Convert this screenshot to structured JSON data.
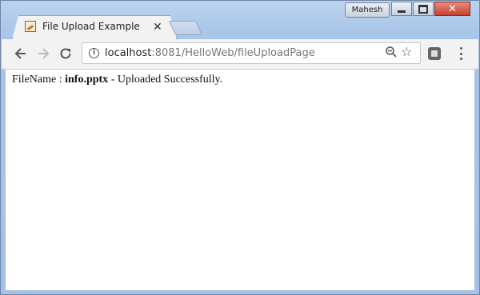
{
  "window": {
    "user_name": "Mahesh"
  },
  "tab": {
    "title": "File Upload Example",
    "close_glyph": "✕"
  },
  "address_bar": {
    "host": "localhost",
    "path": ":8081/HelloWeb/fileUploadPage"
  },
  "page": {
    "label": "FileName : ",
    "file_name": "info.pptx",
    "status": " - Uploaded Successfully."
  },
  "icons": {
    "back": "back-arrow-icon",
    "forward": "forward-arrow-icon",
    "reload": "reload-icon",
    "info": "info-icon",
    "zoom": "zoom-out-icon",
    "bookmark": "star-icon",
    "extension": "extension-icon",
    "menu": "kebab-menu-icon"
  }
}
